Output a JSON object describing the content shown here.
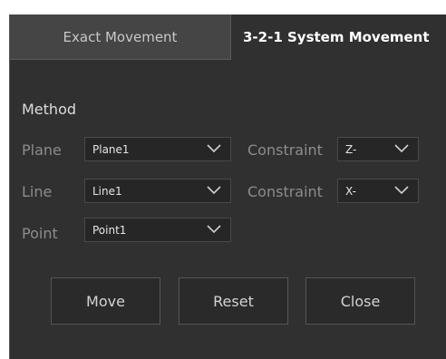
{
  "tabs": [
    {
      "label": "Exact Movement",
      "active": false
    },
    {
      "label": "3-2-1 System  Movement",
      "active": true
    }
  ],
  "method": {
    "label": "Method",
    "plane": {
      "label": "Plane",
      "value": "Plane1",
      "constraint_label": "Constraint",
      "constraint_value": "Z-"
    },
    "line": {
      "label": "Line",
      "value": "Line1",
      "constraint_label": "Constraint",
      "constraint_value": "X-"
    },
    "point": {
      "label": "Point",
      "value": "Point1"
    }
  },
  "buttons": {
    "move": "Move",
    "reset": "Reset",
    "close": "Close"
  },
  "colors": {
    "panel": "#303030",
    "inactive_tab": "#454545",
    "dropdown": "#262626",
    "button": "#2a2a2a"
  }
}
